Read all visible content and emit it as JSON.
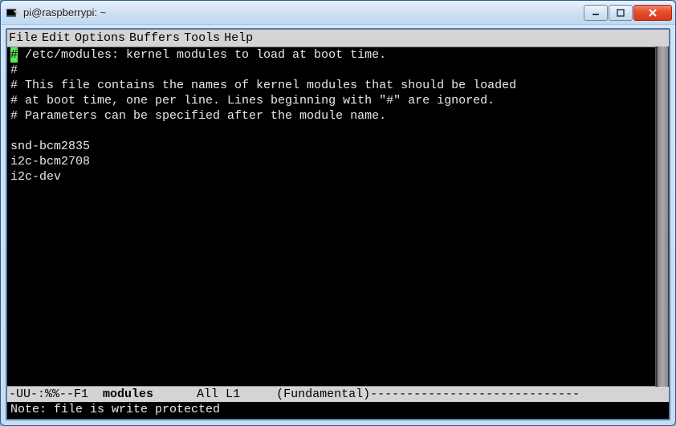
{
  "titlebar": {
    "title": "pi@raspberrypi: ~"
  },
  "menu": {
    "items": [
      "File",
      "Edit",
      "Options",
      "Buffers",
      "Tools",
      "Help"
    ]
  },
  "buffer": {
    "cursor_char": "#",
    "lines_after_cursor": " /etc/modules: kernel modules to load at boot time.\n#\n# This file contains the names of kernel modules that should be loaded\n# at boot time, one per line. Lines beginning with \"#\" are ignored.\n# Parameters can be specified after the module name.\n\nsnd-bcm2835\ni2c-bcm2708\ni2c-dev"
  },
  "modeline": {
    "left": "-UU-:%%--F1  ",
    "buffer_name": "modules",
    "mid": "      All L1     (Fundamental)",
    "dashes": "-----------------------------"
  },
  "minibuffer": {
    "text": "Note: file is write protected"
  }
}
